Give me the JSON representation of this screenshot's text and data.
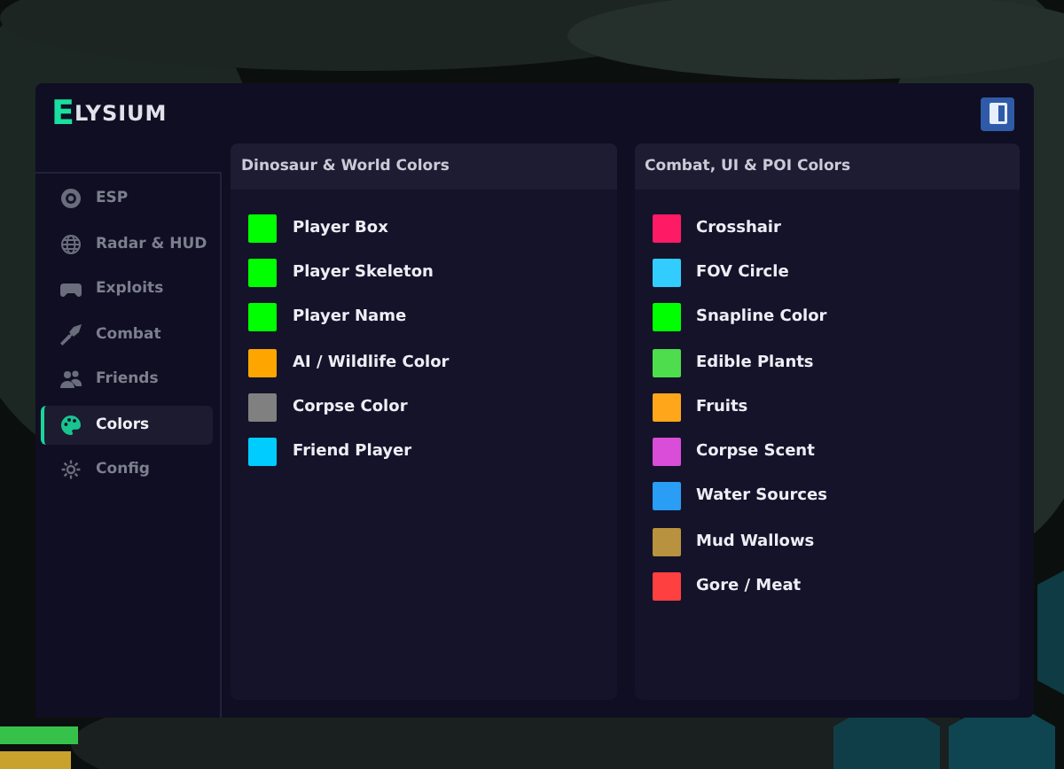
{
  "header": {
    "logo_mark": "E",
    "logo_text": "LYSIUM"
  },
  "sidebar": {
    "items": [
      {
        "label": "ESP",
        "selected": false
      },
      {
        "label": "Radar & HUD",
        "selected": false
      },
      {
        "label": "Exploits",
        "selected": false
      },
      {
        "label": "Combat",
        "selected": false
      },
      {
        "label": "Friends",
        "selected": false
      },
      {
        "label": "Colors",
        "selected": true
      },
      {
        "label": "Config",
        "selected": false
      }
    ]
  },
  "panels": [
    {
      "title": "Dinosaur & World Colors",
      "items": [
        {
          "label": "Player Box",
          "color": "#00ff00"
        },
        {
          "label": "Player Skeleton",
          "color": "#00ff00"
        },
        {
          "label": "Player Name",
          "color": "#00ff00"
        },
        {
          "label": "AI / Wildlife Color",
          "color": "#ffa500"
        },
        {
          "label": "Corpse Color",
          "color": "#808080"
        },
        {
          "label": "Friend Player",
          "color": "#00ccff"
        }
      ]
    },
    {
      "title": "Combat, UI & POI Colors",
      "items": [
        {
          "label": "Crosshair",
          "color": "#ff1a66"
        },
        {
          "label": "FOV Circle",
          "color": "#33ccff"
        },
        {
          "label": "Snapline Color",
          "color": "#00ff00"
        },
        {
          "label": "Edible Plants",
          "color": "#4ddd4d"
        },
        {
          "label": "Fruits",
          "color": "#ffa61a"
        },
        {
          "label": "Corpse Scent",
          "color": "#d94dd9"
        },
        {
          "label": "Water Sources",
          "color": "#2a9df4"
        },
        {
          "label": "Mud Wallows",
          "color": "#b8923f"
        },
        {
          "label": "Gore / Meat",
          "color": "#ff4040"
        }
      ]
    }
  ]
}
